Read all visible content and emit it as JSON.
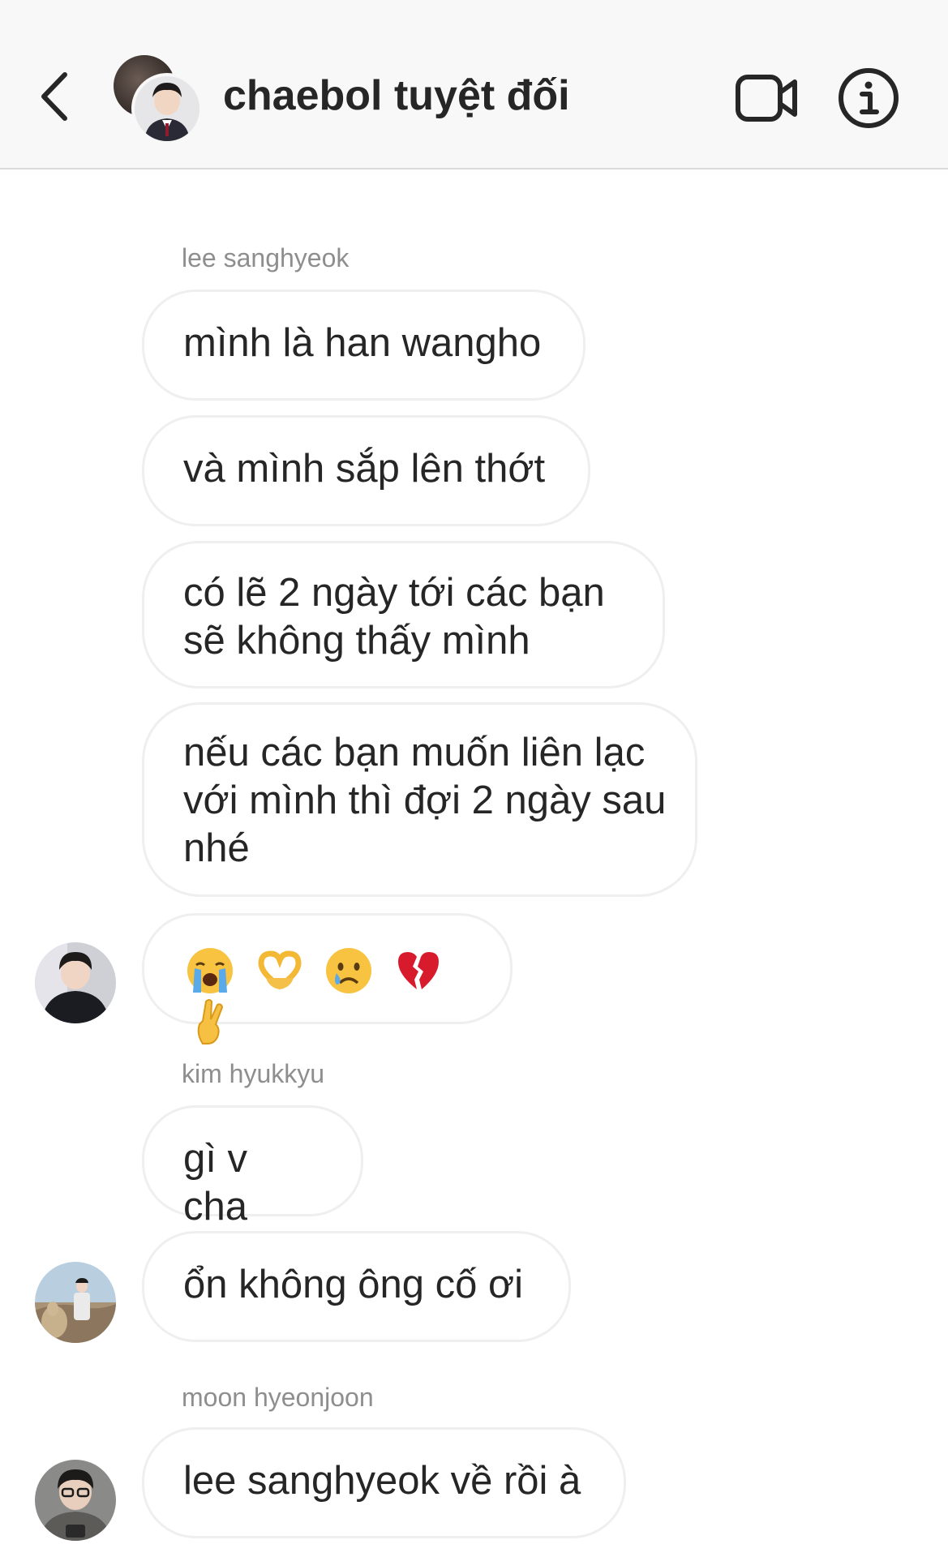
{
  "header": {
    "title": "chaebol tuyệt đối",
    "back_icon": "chevron-left-icon",
    "video_icon": "video-camera-icon",
    "info_icon": "info-icon"
  },
  "messages": [
    {
      "sender": "lee sanghyeok",
      "text": "mình là han wangho"
    },
    {
      "text": "và mình sắp lên thớt"
    },
    {
      "text": "có lẽ 2 ngày tới các bạn sẽ không thấy mình"
    },
    {
      "text": "nếu các bạn muốn liên lạc với mình thì đợi 2 ngày sau nhé"
    },
    {
      "emojis": [
        "loudly-crying-face",
        "heart-hands",
        "crying-face",
        "broken-heart",
        "crossed-fingers"
      ]
    },
    {
      "sender": "kim hyukkyu",
      "text": "gì v cha"
    },
    {
      "text": "ổn không ông cố ơi"
    },
    {
      "sender": "moon hyeonjoon",
      "text": "lee sanghyeok về rồi à"
    }
  ],
  "colors": {
    "header_bg": "#f8f8f8",
    "bubble_border": "#efefef",
    "text": "#262626",
    "sender_text": "#8e8e8e"
  }
}
